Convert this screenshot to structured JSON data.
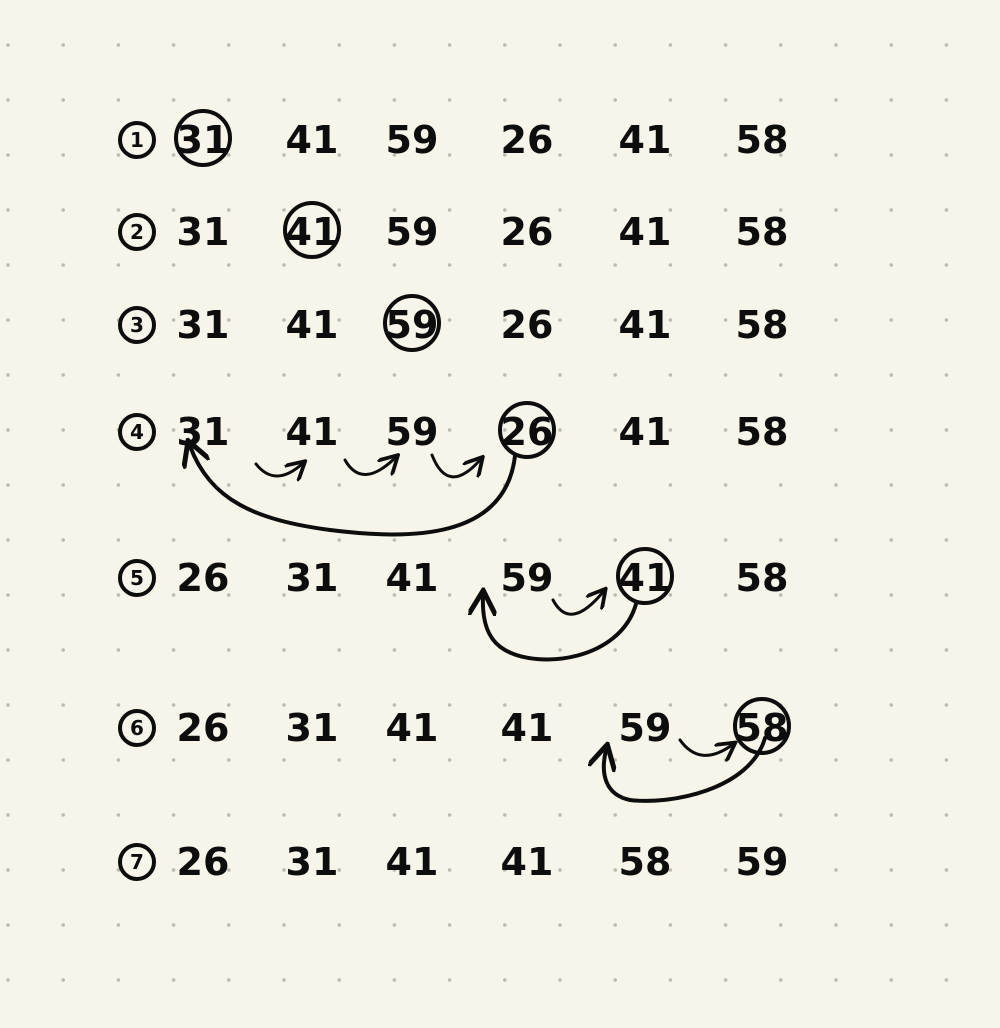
{
  "ink_color": "#0d0d0d",
  "paper_color": "#f7f5ea",
  "dot_color": "#bdbab0",
  "rows": [
    {
      "step": "1",
      "values": [
        "31",
        "41",
        "59",
        "26",
        "41",
        "58"
      ],
      "circled": 0
    },
    {
      "step": "2",
      "values": [
        "31",
        "41",
        "59",
        "26",
        "41",
        "58"
      ],
      "circled": 1
    },
    {
      "step": "3",
      "values": [
        "31",
        "41",
        "59",
        "26",
        "41",
        "58"
      ],
      "circled": 2
    },
    {
      "step": "4",
      "values": [
        "31",
        "41",
        "59",
        "26",
        "41",
        "58"
      ],
      "circled": 3
    },
    {
      "step": "5",
      "values": [
        "26",
        "31",
        "41",
        "59",
        "41",
        "58"
      ],
      "circled": 4
    },
    {
      "step": "6",
      "values": [
        "26",
        "31",
        "41",
        "41",
        "59",
        "58"
      ],
      "circled": 5
    },
    {
      "step": "7",
      "values": [
        "26",
        "31",
        "41",
        "41",
        "58",
        "59"
      ],
      "circled": -1
    }
  ]
}
